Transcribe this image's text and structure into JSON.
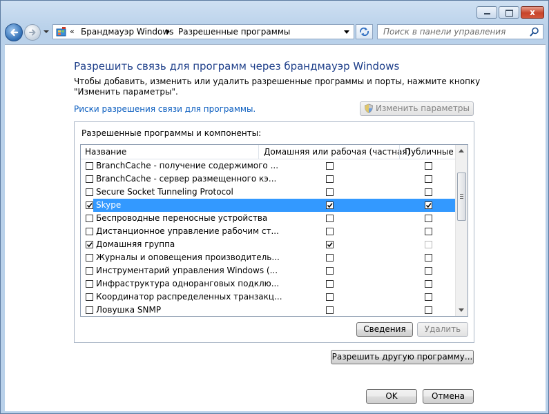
{
  "address": {
    "overflow": "«",
    "crumbs": [
      "Брандмауэр Windows",
      "Разрешенные программы"
    ]
  },
  "search": {
    "placeholder": "Поиск в панели управления"
  },
  "heading": "Разрешить связь для программ через брандмауэр Windows",
  "description": "Чтобы добавить, изменить или удалить разрешенные программы и порты, нажмите кнопку \"Изменить параметры\".",
  "risk_link": "Риски разрешения связи для программы.",
  "change_settings_label": "Изменить параметры",
  "group_label": "Разрешенные программы и компоненты:",
  "columns": {
    "name": "Название",
    "private": "Домашняя или рабочая (частная)",
    "public": "Публичные"
  },
  "rows": [
    {
      "name": "BranchCache - получение содержимого ...",
      "enabled": false,
      "private": false,
      "public": false
    },
    {
      "name": "BranchCache - сервер размещенного кэ...",
      "enabled": false,
      "private": false,
      "public": false
    },
    {
      "name": "Secure Socket Tunneling Protocol",
      "enabled": false,
      "private": false,
      "public": false
    },
    {
      "name": "Skype",
      "enabled": true,
      "private": true,
      "public": true,
      "selected": true
    },
    {
      "name": "Беспроводные переносные устройства",
      "enabled": false,
      "private": false,
      "public": false
    },
    {
      "name": "Дистанционное управление рабочим ст...",
      "enabled": false,
      "private": false,
      "public": false
    },
    {
      "name": "Домашняя группа",
      "enabled": true,
      "private": true,
      "public": false,
      "public_disabled": true
    },
    {
      "name": "Журналы и оповещения производитель...",
      "enabled": false,
      "private": false,
      "public": false
    },
    {
      "name": "Инструментарий управления Windows (...",
      "enabled": false,
      "private": false,
      "public": false
    },
    {
      "name": "Инфраструктура одноранговых подклю...",
      "enabled": false,
      "private": false,
      "public": false
    },
    {
      "name": "Координатор распределенных транзакц...",
      "enabled": false,
      "private": false,
      "public": false
    },
    {
      "name": "Ловушка SNMP",
      "enabled": false,
      "private": false,
      "public": false
    }
  ],
  "buttons": {
    "details": "Сведения",
    "delete": "Удалить",
    "allow_other": "Разрешить другую программу...",
    "ok": "OK",
    "cancel": "Отмена"
  },
  "window_buttons": {
    "close": "x"
  }
}
